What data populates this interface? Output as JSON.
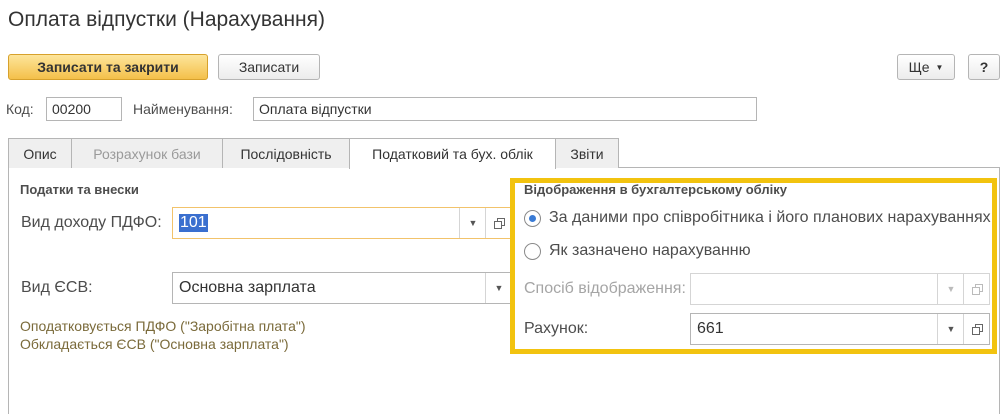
{
  "title": "Оплата відпустки (Нарахування)",
  "toolbar": {
    "save_close": "Записати та закрити",
    "save": "Записати",
    "more": "Ще",
    "help": "?"
  },
  "code": {
    "label": "Код:",
    "value": "00200"
  },
  "name": {
    "label": "Найменування:",
    "value": "Оплата відпустки"
  },
  "tabs": [
    {
      "label": "Опис"
    },
    {
      "label": "Розрахунок бази"
    },
    {
      "label": "Послідовність"
    },
    {
      "label": "Податковий та бух. облік"
    },
    {
      "label": "Звіти"
    }
  ],
  "taxes": {
    "group_title": "Податки та внески",
    "pdfo_label": "Вид доходу ПДФО:",
    "pdfo_value": "101",
    "esv_label": "Вид ЄСВ:",
    "esv_value": "Основна зарплата",
    "note1": "Оподатковується ПДФО (\"Заробітна плата\")",
    "note2": "Обкладається ЄСВ (\"Основна зарплата\")"
  },
  "accounting": {
    "group_title": "Відображення в бухгалтерському обліку",
    "radio1": "За даними про співробітника і його планових нарахуваннях",
    "radio2": "Як зазначено нарахуванню",
    "method_label": "Спосіб відображення:",
    "method_value": "",
    "account_label": "Рахунок:",
    "account_value": "661"
  },
  "highlight_color": "#f2c30f"
}
